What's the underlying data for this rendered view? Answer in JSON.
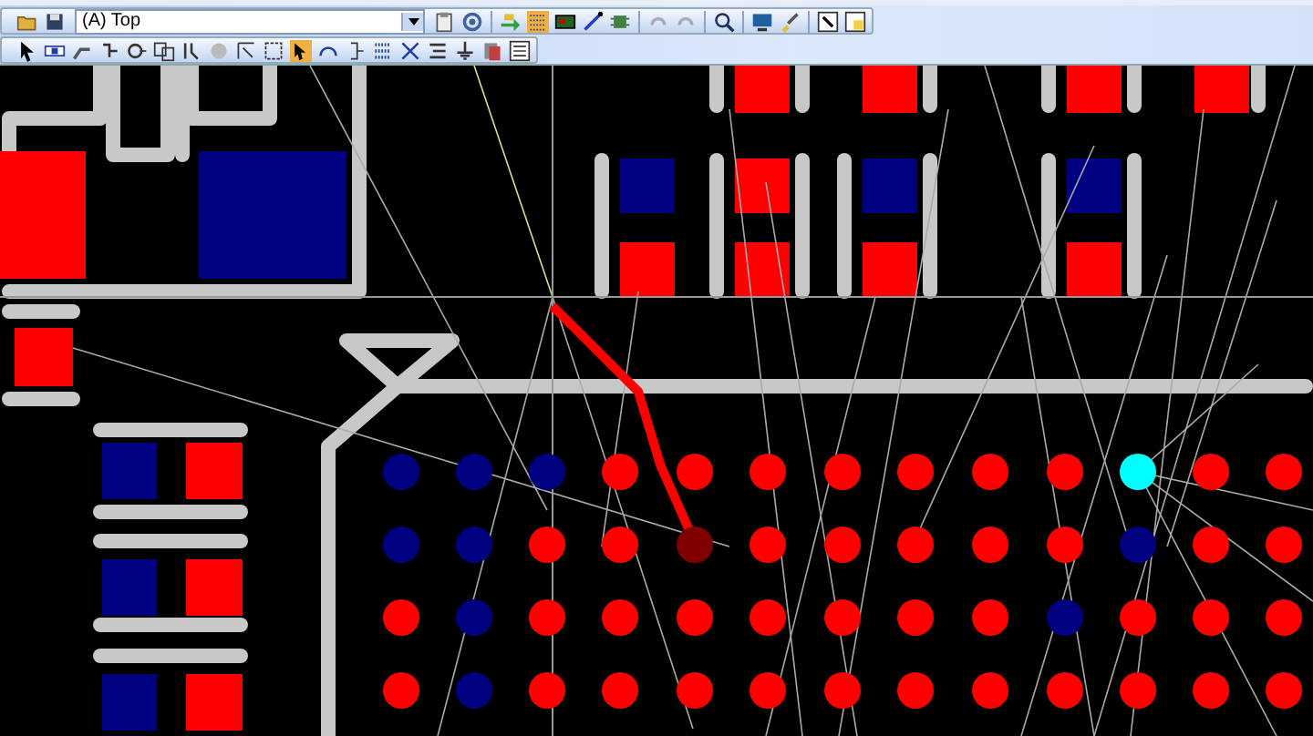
{
  "toolbar": {
    "layer_select": {
      "value": "(A) Top"
    }
  }
}
